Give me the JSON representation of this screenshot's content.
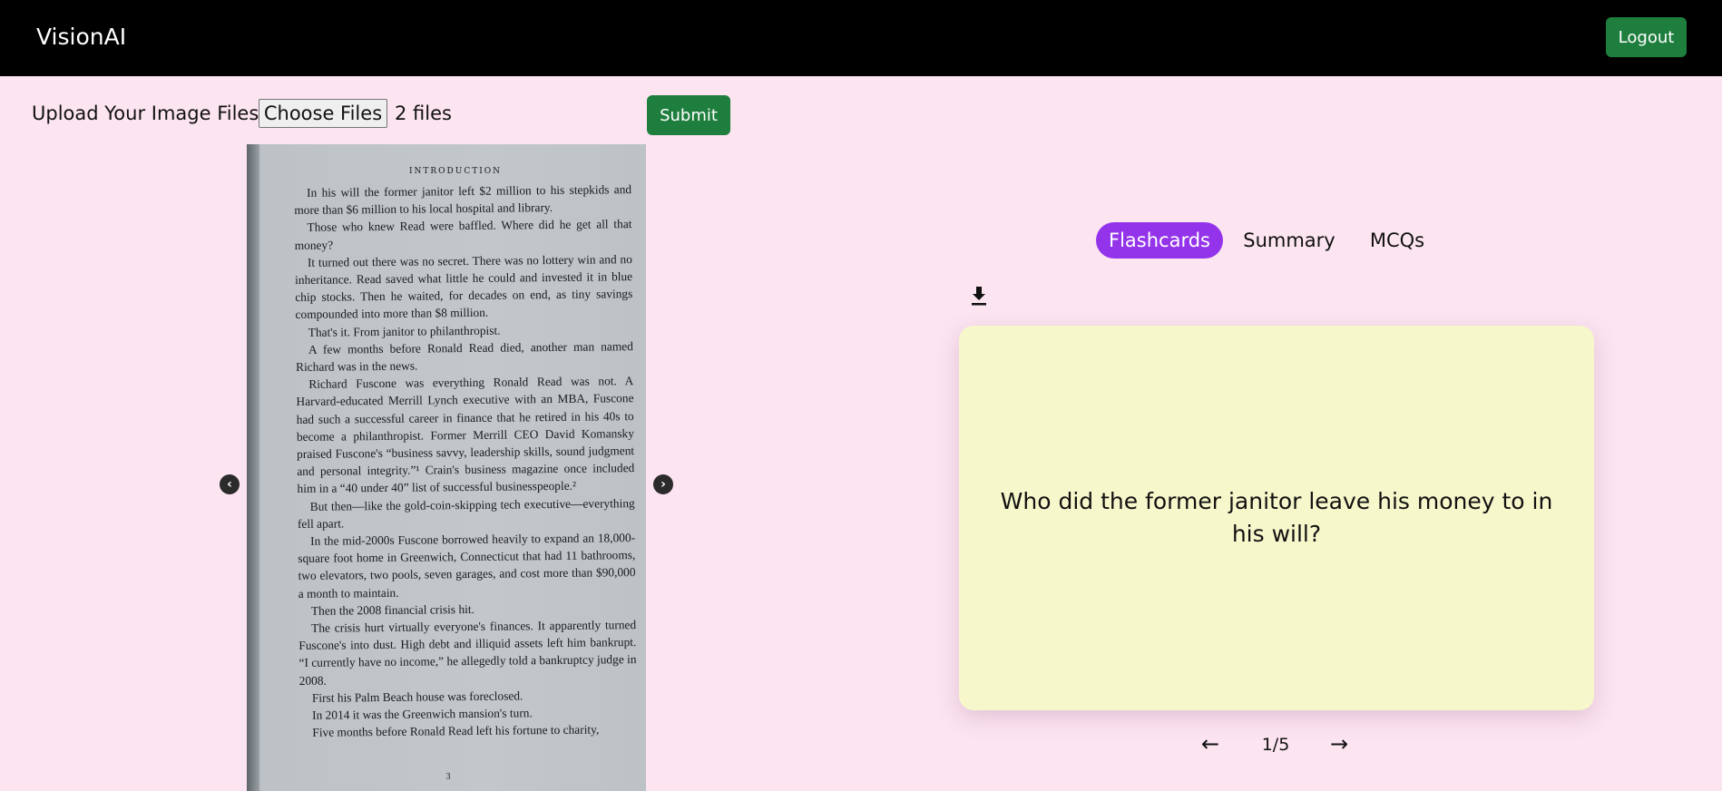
{
  "header": {
    "brand": "VisionAI",
    "logout_label": "Logout"
  },
  "upload": {
    "label": "Upload Your Image Files",
    "choose_label": "Choose Files",
    "file_count": "2 files",
    "submit_label": "Submit"
  },
  "image_viewer": {
    "prev_icon": "chevron-left-icon",
    "next_icon": "chevron-right-icon",
    "page": {
      "heading": "INTRODUCTION",
      "paragraphs": [
        "In his will the former janitor left $2 million to his stepkids and more than $6 million to his local hospital and library.",
        "Those who knew Read were baffled. Where did he get all that money?",
        "It turned out there was no secret. There was no lottery win and no inheritance. Read saved what little he could and invested it in blue chip stocks. Then he waited, for decades on end, as tiny savings compounded into more than $8 million.",
        "That's it. From janitor to philanthropist.",
        "A few months before Ronald Read died, another man named Richard was in the news.",
        "Richard Fuscone was everything Ronald Read was not. A Harvard-educated Merrill Lynch executive with an MBA, Fuscone had such a successful career in finance that he retired in his 40s to become a philanthropist. Former Merrill CEO David Komansky praised Fuscone's “business savvy, leadership skills, sound judgment and personal integrity.”¹ Crain's business magazine once included him in a “40 under 40” list of successful businesspeople.²",
        "But then—like the gold-coin-skipping tech executive—everything fell apart.",
        "In the mid-2000s Fuscone borrowed heavily to expand an 18,000-square foot home in Greenwich, Connecticut that had 11 bathrooms, two elevators, two pools, seven garages, and cost more than $90,000 a month to maintain.",
        "Then the 2008 financial crisis hit.",
        "The crisis hurt virtually everyone's finances. It apparently turned Fuscone's into dust. High debt and illiquid assets left him bankrupt. “I currently have no income,” he allegedly told a bankruptcy judge in 2008.",
        "First his Palm Beach house was foreclosed.",
        "In 2014 it was the Greenwich mansion's turn.",
        "Five months before Ronald Read left his fortune to charity,"
      ],
      "page_number": "3"
    }
  },
  "tabs": {
    "flashcards": "Flashcards",
    "summary": "Summary",
    "mcqs": "MCQs",
    "active": "Flashcards"
  },
  "download_icon": "download-icon",
  "flashcard": {
    "question": "Who did the former janitor leave his money to in his will?",
    "prev_glyph": "←",
    "next_glyph": "→",
    "counter": "1/5"
  },
  "colors": {
    "background": "#fce4f1",
    "topbar": "#000000",
    "button_green": "#1e7e3e",
    "tab_active": "#9333ea",
    "card": "#f7f7cc"
  }
}
